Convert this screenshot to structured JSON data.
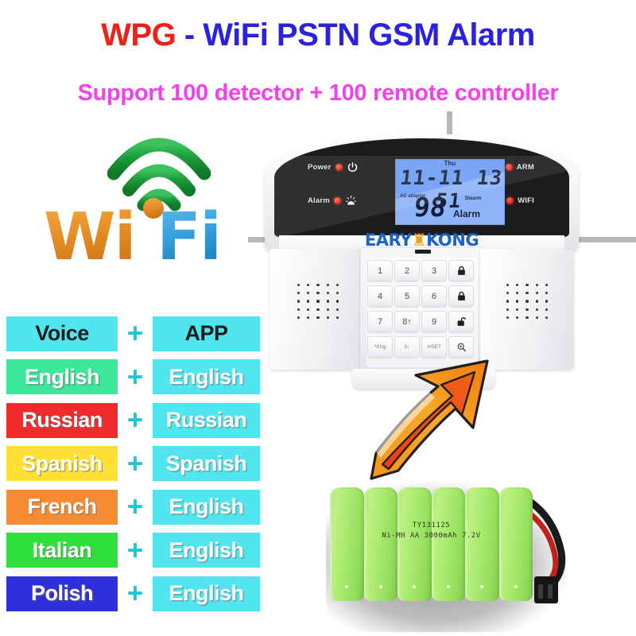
{
  "headline": {
    "brand": "WPG",
    "rest": " - WiFi PSTN GSM Alarm",
    "brand_color": "#f02018",
    "rest_color": "#2a22e0"
  },
  "subheadline": {
    "text": "Support 100 detector + 100 remote controller",
    "color": "#f63ff0"
  },
  "wifi_logo": {
    "word_wi": "Wi",
    "word_fi": "Fi",
    "arc_color": "#1e9b3c",
    "wi_color": "#e8912a",
    "fi_color": "#3aa5e0"
  },
  "panel": {
    "brand_left": "EARY",
    "brand_crown": "♜",
    "brand_right": "KONG",
    "indicators": [
      {
        "label": "Power",
        "icon": "power-icon",
        "led": "#d9281a"
      },
      {
        "label": "Alarm",
        "icon": "siren-icon",
        "led": "#d9281a"
      },
      {
        "label": "ARM",
        "icon": "home-lock-icon",
        "led": "#d9281a"
      },
      {
        "label": "WIFI",
        "icon": "wifi-icon",
        "led": "#d9281a"
      }
    ],
    "lcd": {
      "day": "Thu",
      "time": "11-11 13 51",
      "ac_label": "AC adaptor",
      "disarm_label": "Disarm",
      "zone": "98",
      "alarm_label": "Alarm",
      "background": "#6f9ef6"
    },
    "keypad": [
      {
        "label": "1",
        "icon": ""
      },
      {
        "label": "2",
        "icon": ""
      },
      {
        "label": "3",
        "icon": ""
      },
      {
        "label": "",
        "icon": "lock-closed-icon"
      },
      {
        "label": "4",
        "icon": ""
      },
      {
        "label": "5",
        "icon": ""
      },
      {
        "label": "6",
        "icon": ""
      },
      {
        "label": "",
        "icon": "lock-closed-icon"
      },
      {
        "label": "7",
        "icon": ""
      },
      {
        "label": "8↑",
        "icon": ""
      },
      {
        "label": "9",
        "icon": ""
      },
      {
        "label": "",
        "icon": "lock-open-icon"
      },
      {
        "label": "*/Urg",
        "icon": ""
      },
      {
        "label": "0↓",
        "icon": ""
      },
      {
        "label": "#/SET",
        "icon": ""
      },
      {
        "label": "",
        "icon": "magnifier-icon"
      }
    ]
  },
  "language_table": [
    {
      "voice": "Voice",
      "app": "APP",
      "color": "#50e6f0",
      "text_style": "dark"
    },
    {
      "voice": "English",
      "app": "English",
      "color": "#3ce69a",
      "text_style": "white"
    },
    {
      "voice": "Russian",
      "app": "Russian",
      "color": "#ef2b2b",
      "text_style": "white"
    },
    {
      "voice": "Spanish",
      "app": "Spanish",
      "color": "#ffe033",
      "text_style": "white"
    },
    {
      "voice": "French",
      "app": "English",
      "color": "#f68b33",
      "text_style": "white"
    },
    {
      "voice": "Italian",
      "app": "English",
      "color": "#2fe03c",
      "text_style": "white"
    },
    {
      "voice": "Polish",
      "app": "English",
      "color": "#2f2fdb",
      "text_style": "white"
    }
  ],
  "plus_symbol": "+",
  "battery": {
    "code": "TY131125",
    "spec": "Ni-MH AA 3000mAh 7.2V",
    "cell_count": 6,
    "color": "#a9ea6f"
  },
  "arrow": {
    "name": "orange-arrow",
    "fill_light": "#f79a1e",
    "fill_dark": "#ee3a10"
  }
}
